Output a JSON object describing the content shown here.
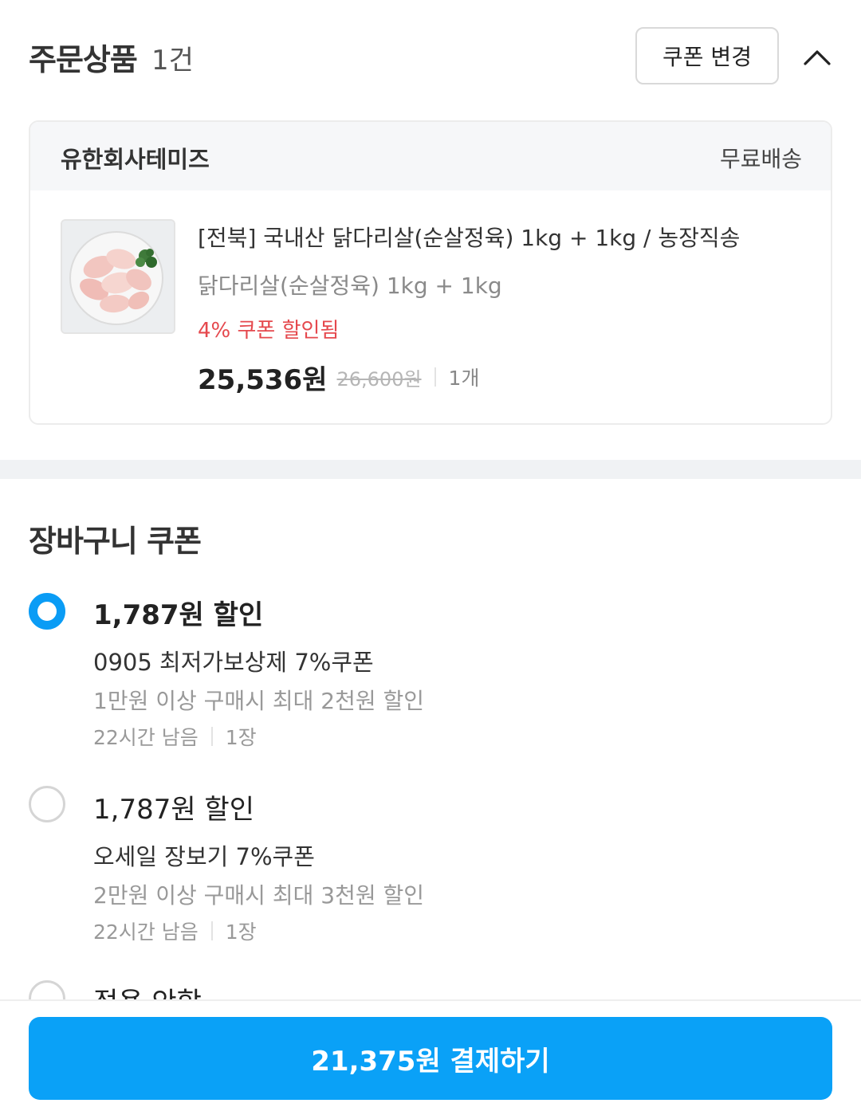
{
  "order": {
    "title": "주문상품",
    "count": "1건",
    "coupon_change_label": "쿠폰 변경",
    "collapse_icon": "chevron-up-icon"
  },
  "product_card": {
    "seller": "유한회사테미즈",
    "shipping": "무료배송",
    "thumbnail_icon": "raw-chicken-thigh-image",
    "name": "[전북] 국내산 닭다리살(순살정육) 1kg + 1kg / 농장직송",
    "option": "닭다리살(순살정육) 1kg + 1kg",
    "coupon_applied": "4% 쿠폰 할인됨",
    "sale_price": "25,536원",
    "original_price": "26,600원",
    "quantity": "1개"
  },
  "cart_coupon": {
    "title": "장바구니 쿠폰",
    "options": [
      {
        "selected": true,
        "amount": "1,787원 할인",
        "name": "0905 최저가보상제 7%쿠폰",
        "condition": "1만원 이상 구매시 최대 2천원 할인",
        "remaining": "22시간 남음",
        "count": "1장"
      },
      {
        "selected": false,
        "amount": "1,787원 할인",
        "name": "오세일 장보기 7%쿠폰",
        "condition": "2만원 이상 구매시 최대 3천원 할인",
        "remaining": "22시간 남음",
        "count": "1장"
      },
      {
        "selected": false,
        "amount": "적용 안함"
      }
    ]
  },
  "checkout": {
    "pay_label": "21,375원 결제하기"
  },
  "colors": {
    "accent": "#0aa1f7",
    "radio_selected": "#0a9cf5",
    "discount_red": "#e5484d"
  }
}
